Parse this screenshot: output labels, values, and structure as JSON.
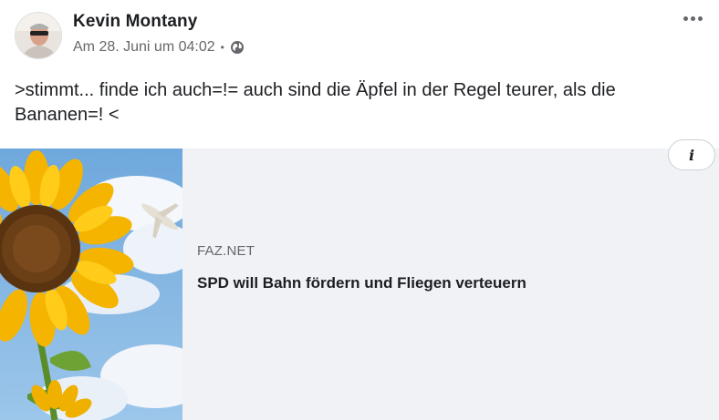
{
  "post": {
    "author_name": "Kevin Montany",
    "timestamp": "Am 28. Juni um 04:02",
    "separator": "•",
    "privacy_icon": "globe-icon",
    "more_icon": "more-options-icon",
    "text": ">stimmt... finde ich auch=!= auch sind die Äpfel in der Regel teurer, als die Bananen=! <"
  },
  "link_preview": {
    "thumbnail": "sunflower-image",
    "info_icon": "info-icon",
    "info_label": "i",
    "domain": "FAZ.NET",
    "headline": "SPD will Bahn fördern und Fliegen verteuern"
  },
  "colors": {
    "text_primary": "#1c1e21",
    "text_secondary": "#65676b",
    "card_background": "#f0f2f5"
  }
}
